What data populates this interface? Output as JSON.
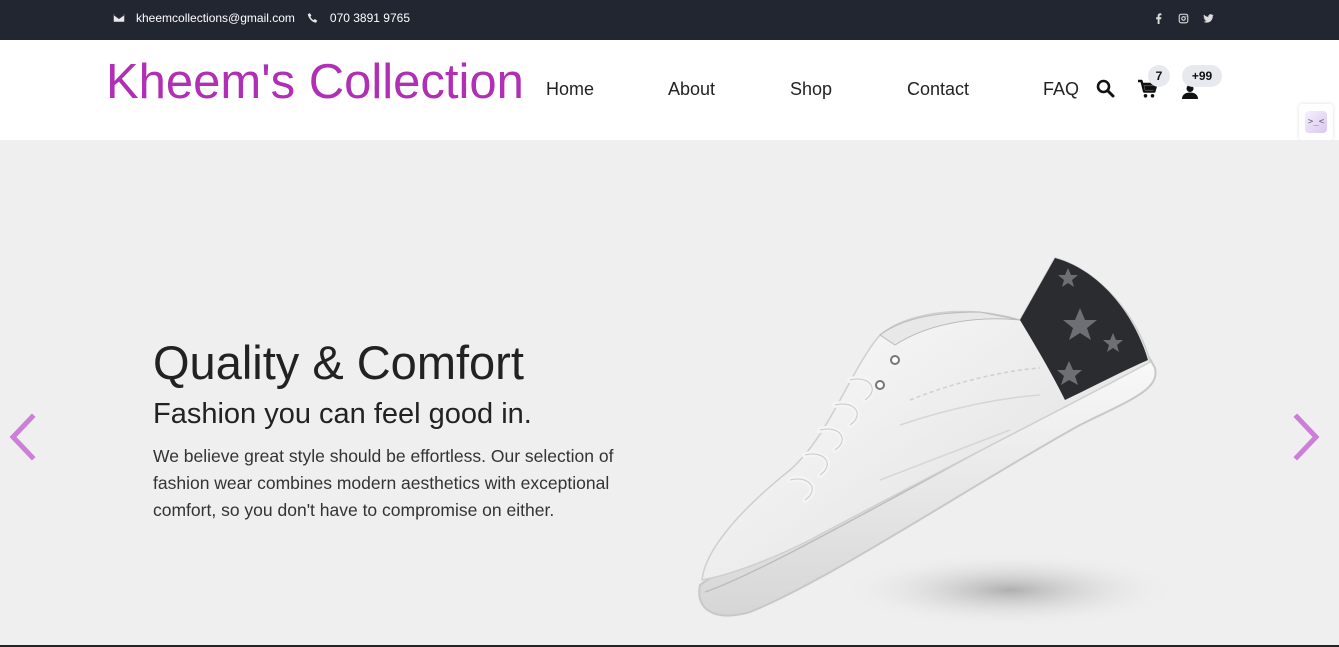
{
  "topbar": {
    "email": "kheemcollections@gmail.com",
    "phone": "070 3891 9765",
    "social": [
      "facebook-icon",
      "instagram-icon",
      "twitter-icon"
    ]
  },
  "header": {
    "logo": "Kheem's Collection",
    "nav": [
      "Home",
      "About",
      "Shop",
      "Contact",
      "FAQ"
    ],
    "cart_count": "7",
    "user_badge": "+99"
  },
  "side_widget": {
    "label": ">_<"
  },
  "hero": {
    "title": "Quality & Comfort",
    "subtitle": "Fashion you can feel good in.",
    "description": "We believe great style should be effortless. Our selection of fashion wear combines modern aesthetics with exceptional comfort, so you don't have to compromise on either."
  },
  "colors": {
    "brand": "#b02fb4",
    "topbar_bg": "#212631",
    "hero_bg": "#efefef",
    "arrow": "#cc7fd6"
  }
}
